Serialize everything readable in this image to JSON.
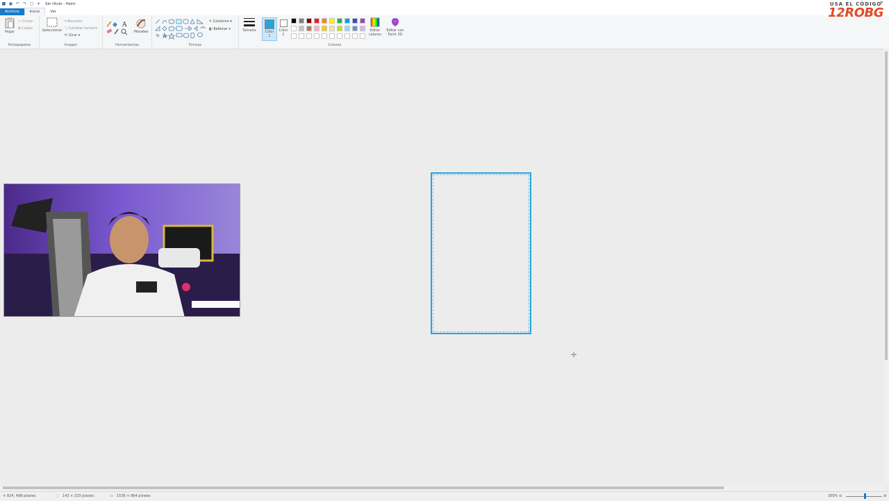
{
  "window": {
    "title": "Sin título - Paint",
    "close_glyph": "✕"
  },
  "quick_access": {
    "icons": [
      "paint-app-icon",
      "save-icon",
      "undo-icon",
      "redo-icon",
      "new-icon",
      "dropdown-icon"
    ]
  },
  "tabs": [
    {
      "label": "Archivo"
    },
    {
      "label": "Inicio"
    },
    {
      "label": "Ver"
    }
  ],
  "ribbon": {
    "clipboard": {
      "paste": "Pegar",
      "cut": "Cortar",
      "copy": "Copiar",
      "group": "Portapapeles"
    },
    "image": {
      "select": "Seleccionar",
      "crop": "Recortar",
      "resize": "Cambiar tamaño",
      "rotate": "Girar ▾",
      "group": "Imagen"
    },
    "tools": {
      "brushes": "Pinceles",
      "group": "Herramientas"
    },
    "shapes": {
      "outline": "Contorno ▾",
      "fill": "Rellenar ▾",
      "group": "Formas"
    },
    "size": {
      "label": "Tamaño"
    },
    "colors": {
      "color1": "Color",
      "color1_num": "1",
      "color2": "Color",
      "color2_num": "2",
      "edit_colors": "Editar",
      "edit_colors2": "colores",
      "paint3d": "Editar con",
      "paint3d2": "Paint 3D",
      "group": "Colores",
      "color1_value": "#29a3d8",
      "color2_value": "#ffffff",
      "palette": [
        "#000000",
        "#7f7f7f",
        "#880015",
        "#ed1c24",
        "#ff7f27",
        "#fff200",
        "#22b14c",
        "#00a2e8",
        "#3f48cc",
        "#a349a4",
        "#ffffff",
        "#c3c3c3",
        "#b97a57",
        "#ffaec9",
        "#ffc90e",
        "#efe4b0",
        "#b5e61d",
        "#99d9ea",
        "#7092be",
        "#c8bfe7",
        "#ffffff",
        "#ffffff",
        "#ffffff",
        "#ffffff",
        "#ffffff",
        "#ffffff",
        "#ffffff",
        "#ffffff",
        "#ffffff",
        "#ffffff"
      ]
    }
  },
  "overlay": {
    "promo_small": "USA EL CÓDIGO",
    "promo_code": "12ROBG"
  },
  "canvas": {
    "selection_color": "#2ba3d6"
  },
  "status": {
    "cursor_pos": "824, 498 píxeles",
    "selection_size": "143 × 233 píxeles",
    "image_size": "1536 × 864 píxeles",
    "zoom": "200%"
  }
}
